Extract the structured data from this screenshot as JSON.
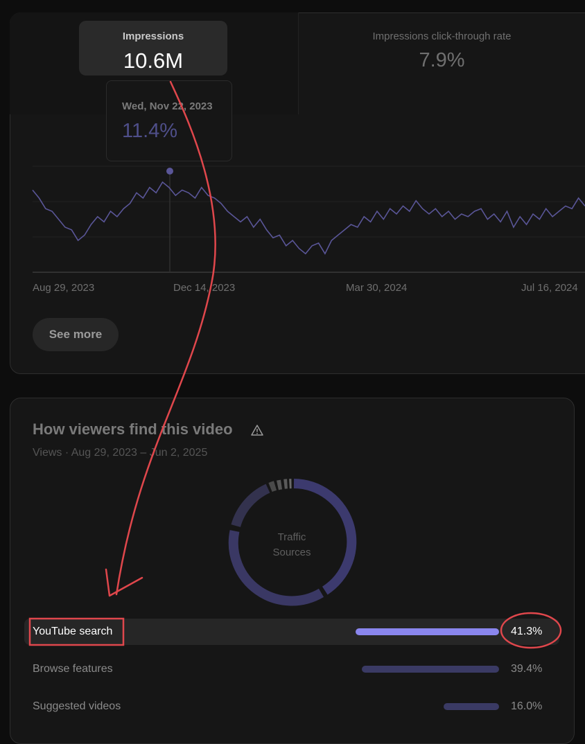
{
  "metrics": {
    "impressions": {
      "label": "Impressions",
      "value": "10.6M"
    },
    "ctr": {
      "label": "Impressions click-through rate",
      "value": "7.9%"
    }
  },
  "tooltip": {
    "date": "Wed, Nov 22, 2023",
    "value": "11.4%"
  },
  "chart_data": {
    "type": "line",
    "x_ticks": [
      "Aug 29, 2023",
      "Dec 14, 2023",
      "Mar 30, 2024",
      "Jul 16, 2024"
    ],
    "y_values": [
      11.6,
      11.3,
      10.9,
      10.8,
      10.5,
      10.2,
      10.1,
      9.7,
      9.9,
      10.3,
      10.6,
      10.4,
      10.8,
      10.6,
      10.9,
      11.1,
      11.5,
      11.3,
      11.7,
      11.5,
      11.9,
      11.7,
      11.4,
      11.6,
      11.5,
      11.3,
      11.7,
      11.4,
      11.3,
      11.1,
      10.8,
      10.6,
      10.4,
      10.6,
      10.2,
      10.5,
      10.1,
      9.8,
      9.9,
      9.5,
      9.7,
      9.4,
      9.2,
      9.5,
      9.6,
      9.2,
      9.7,
      9.9,
      10.1,
      10.3,
      10.2,
      10.6,
      10.4,
      10.8,
      10.5,
      10.9,
      10.7,
      11.0,
      10.8,
      11.2,
      10.9,
      10.7,
      10.9,
      10.6,
      10.8,
      10.5,
      10.7,
      10.6,
      10.8,
      10.9,
      10.5,
      10.7,
      10.4,
      10.8,
      10.2,
      10.6,
      10.3,
      10.7,
      10.5,
      10.9,
      10.6,
      10.8,
      11.0,
      10.9,
      11.3,
      11.0
    ],
    "ylim": [
      8.5,
      12.5
    ]
  },
  "see_more": "See more",
  "sources": {
    "title": "How viewers find this video",
    "subtitle": "Views · Aug 29, 2023 – Jun 2, 2025",
    "donut_label": "Traffic Sources",
    "rows": [
      {
        "name": "YouTube search",
        "pct": "41.3%",
        "share": 41.3
      },
      {
        "name": "Browse features",
        "pct": "39.4%",
        "share": 39.4
      },
      {
        "name": "Suggested videos",
        "pct": "16.0%",
        "share": 16.0
      }
    ]
  },
  "colors": {
    "line": "#5a5698",
    "accent": "#8a86ee",
    "annotation": "#e0474c"
  }
}
